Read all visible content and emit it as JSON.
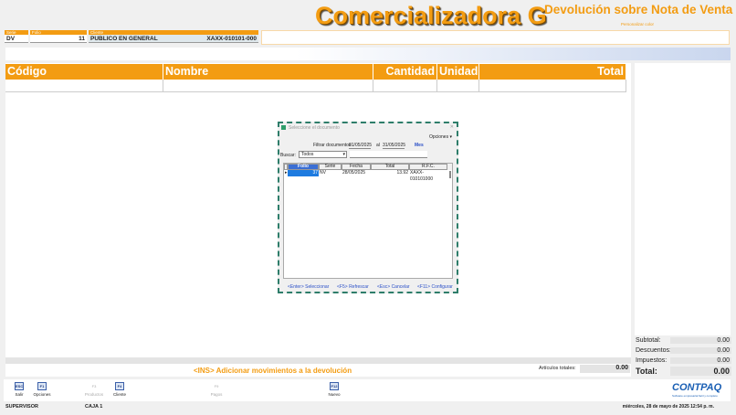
{
  "header": {
    "company": "Comercializadora G",
    "doc_title": "Devolución sobre Nota de Venta",
    "customize_color": "Personalizar color",
    "serie_label": "Serie",
    "serie": "DV",
    "folio_label": "Folio",
    "folio": "11",
    "cliente_label": "Cliente",
    "cliente": "PUBLICO EN GENERAL",
    "rfc": "XAXX-010101-000"
  },
  "table": {
    "columns": [
      "Código",
      "Nombre",
      "Cantidad",
      "Unidad",
      "Total"
    ]
  },
  "dialog": {
    "title": "Seleccione el documento",
    "options": "Opciones ▾",
    "filter_label": "Filtrar documentos",
    "date_from": "01/05/2025",
    "al": "al",
    "date_to": "31/05/2025",
    "mes": "Mes",
    "search_label": "Buscar:",
    "search_option": "Todos",
    "columns": [
      "Folio",
      "Serie",
      "Fecha",
      "Total",
      "R.F.C."
    ],
    "rows": [
      {
        "folio": "37",
        "serie": "NV",
        "fecha": "28/05/2025",
        "total": "13.92",
        "rfc": "XAXX-010101000"
      }
    ],
    "footer": [
      "<Enter> Seleccionar",
      "<F5> Refrescar",
      "<Esc> Cancelar",
      "<F11> Configurar"
    ]
  },
  "ins_hint": "<INS> Adicionar movimientos a la devolución",
  "articulos": {
    "label": "Artículos totales:",
    "value": "0.00"
  },
  "totals": {
    "subtotal_label": "Subtotal:",
    "subtotal": "0.00",
    "descuentos_label": "Descuentos:",
    "descuentos": "0.00",
    "impuestos_label": "Impuestos:",
    "impuestos": "0.00",
    "total_label": "Total:",
    "total": "0.00"
  },
  "toolbar": [
    {
      "key": "ESC",
      "label": "Salir",
      "enabled": true
    },
    {
      "key": "F1",
      "label": "Opciones",
      "enabled": true
    },
    {
      "key": "F3",
      "label": "Productos",
      "enabled": false
    },
    {
      "key": "F4",
      "label": "Cliente",
      "enabled": true
    },
    {
      "key": "F9",
      "label": "Pagos",
      "enabled": false
    },
    {
      "key": "F12",
      "label": "Nuevo",
      "enabled": true
    }
  ],
  "logo": {
    "name": "CONTPAQ",
    "tagline": "Software empresarial fácil y completo"
  },
  "status": {
    "user": "SUPERVISOR",
    "caja": "CAJA 1",
    "datetime": "miércoles, 28 de mayo de 2025  12:54 p. m."
  }
}
